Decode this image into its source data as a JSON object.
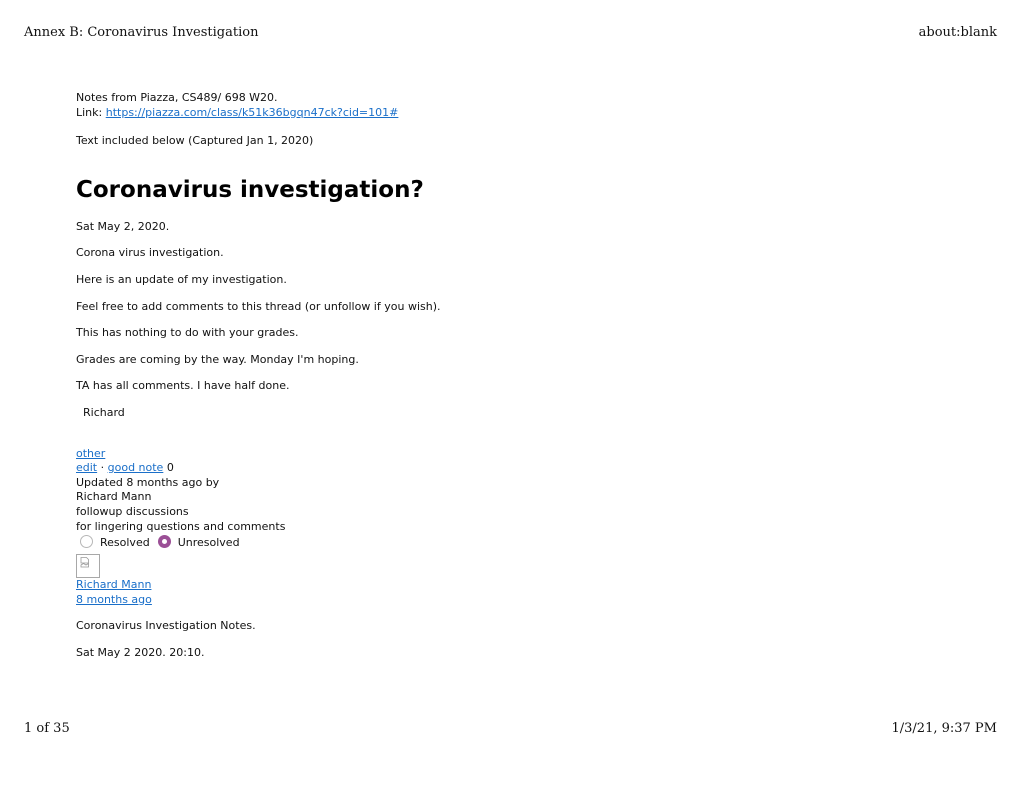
{
  "print_header": {
    "title": "Annex B: Coronavirus Investigation",
    "url": "about:blank"
  },
  "print_footer": {
    "page": "1 of 35",
    "datetime": "1/3/21, 9:37 PM"
  },
  "intro": {
    "notes_line": "Notes from Piazza, CS489/ 698 W20.",
    "link_label": "Link: ",
    "link_text": "https://piazza.com/class/k51k36bgqn47ck?cid=101#",
    "captured_line": "Text included below (Captured Jan 1, 2020)"
  },
  "post": {
    "title": "Coronavirus investigation?",
    "paragraphs": [
      "Sat May 2, 2020.",
      "Corona virus investigation.",
      "Here is an update of my investigation.",
      "Feel free to add comments to this thread (or unfollow if you wish).",
      "This has nothing to do with your grades.",
      "Grades are coming by the way.  Monday I'm hoping.",
      "TA has all comments.  I have half done."
    ],
    "signature": "Richard"
  },
  "meta": {
    "folder_link": "other",
    "edit_link": "edit",
    "separator": " · ",
    "good_note_link": "good note",
    "good_note_count": " 0",
    "updated_text": "Updated 8 months ago by",
    "author": "Richard Mann",
    "followup_title": "followup discussions",
    "followup_subtitle": "for lingering questions and comments",
    "resolved_label": "Resolved",
    "unresolved_label": "Unresolved",
    "selected_status": "Unresolved",
    "accent_color": "#9b4f96",
    "link_color": "#1a6fc9"
  },
  "followup": {
    "author_link": "Richard Mann",
    "time_link": "8 months ago",
    "paragraphs": [
      "Coronavirus Investigation Notes.",
      "Sat May 2 2020.  20:10."
    ]
  }
}
